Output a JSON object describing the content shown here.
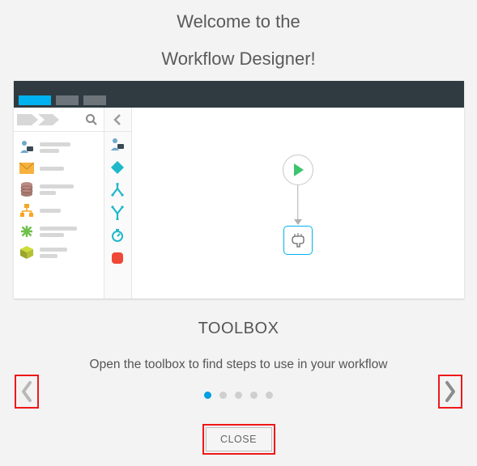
{
  "header": {
    "line1": "Welcome to the",
    "line2": "Workflow Designer!"
  },
  "step": {
    "title": "TOOLBOX",
    "text": "Open the toolbox to find steps to use in your workflow"
  },
  "close_label": "CLOSE",
  "pagination": {
    "count": 5,
    "active": 0
  }
}
